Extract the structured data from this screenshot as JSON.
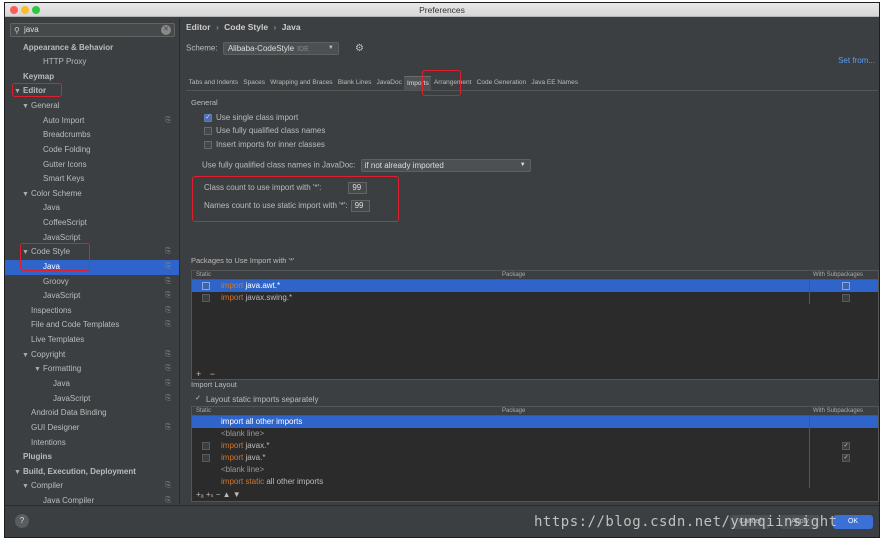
{
  "window": {
    "title": "Preferences"
  },
  "search": {
    "value": "java"
  },
  "sidebar": {
    "items": [
      {
        "label": "Appearance & Behavior",
        "depth": 0,
        "bold": true,
        "arrow": ""
      },
      {
        "label": "HTTP Proxy",
        "depth": 2,
        "arrow": ""
      },
      {
        "label": "Keymap",
        "depth": 0,
        "bold": true,
        "arrow": ""
      },
      {
        "label": "Editor",
        "depth": 0,
        "bold": true,
        "arrow": "▼"
      },
      {
        "label": "General",
        "depth": 1,
        "arrow": "▼"
      },
      {
        "label": "Auto Import",
        "depth": 2,
        "arrow": "",
        "doc": true
      },
      {
        "label": "Breadcrumbs",
        "depth": 2,
        "arrow": ""
      },
      {
        "label": "Code Folding",
        "depth": 2,
        "arrow": ""
      },
      {
        "label": "Gutter Icons",
        "depth": 2,
        "arrow": ""
      },
      {
        "label": "Smart Keys",
        "depth": 2,
        "arrow": ""
      },
      {
        "label": "Color Scheme",
        "depth": 1,
        "arrow": "▼"
      },
      {
        "label": "Java",
        "depth": 2,
        "arrow": ""
      },
      {
        "label": "CoffeeScript",
        "depth": 2,
        "arrow": ""
      },
      {
        "label": "JavaScript",
        "depth": 2,
        "arrow": ""
      },
      {
        "label": "Code Style",
        "depth": 1,
        "arrow": "▼",
        "doc": true
      },
      {
        "label": "Java",
        "depth": 2,
        "arrow": "",
        "doc": true,
        "selected": true
      },
      {
        "label": "Groovy",
        "depth": 2,
        "arrow": "",
        "doc": true
      },
      {
        "label": "JavaScript",
        "depth": 2,
        "arrow": "",
        "doc": true
      },
      {
        "label": "Inspections",
        "depth": 1,
        "arrow": "",
        "doc": true
      },
      {
        "label": "File and Code Templates",
        "depth": 1,
        "arrow": "",
        "doc": true
      },
      {
        "label": "Live Templates",
        "depth": 1,
        "arrow": ""
      },
      {
        "label": "Copyright",
        "depth": 1,
        "arrow": "▼",
        "doc": true
      },
      {
        "label": "Formatting",
        "depth": 2,
        "arrow": "▼",
        "doc": true,
        "indent": 1
      },
      {
        "label": "Java",
        "depth": 3,
        "arrow": "",
        "doc": true
      },
      {
        "label": "JavaScript",
        "depth": 3,
        "arrow": "",
        "doc": true
      },
      {
        "label": "Android Data Binding",
        "depth": 1,
        "arrow": ""
      },
      {
        "label": "GUI Designer",
        "depth": 1,
        "arrow": "",
        "doc": true
      },
      {
        "label": "Intentions",
        "depth": 1,
        "arrow": ""
      },
      {
        "label": "Plugins",
        "depth": 0,
        "bold": true,
        "arrow": ""
      },
      {
        "label": "Build, Execution, Deployment",
        "depth": 0,
        "bold": true,
        "arrow": "▼"
      },
      {
        "label": "Compiler",
        "depth": 1,
        "arrow": "▼",
        "doc": true
      },
      {
        "label": "Java Compiler",
        "depth": 2,
        "arrow": "",
        "doc": true
      }
    ]
  },
  "breadcrumb": {
    "p1": "Editor",
    "sep": "›",
    "p2": "Code Style",
    "p3": "Java"
  },
  "scheme": {
    "label": "Scheme:",
    "value": "Alibaba-CodeStyle",
    "tag": "IDE"
  },
  "set_from": "Set from...",
  "tabs": [
    {
      "label": "Tabs and Indents"
    },
    {
      "label": "Spaces"
    },
    {
      "label": "Wrapping and Braces"
    },
    {
      "label": "Blank Lines"
    },
    {
      "label": "JavaDoc"
    },
    {
      "label": "Imports",
      "active": true
    },
    {
      "label": "Arrangement"
    },
    {
      "label": "Code Generation"
    },
    {
      "label": "Java EE Names"
    }
  ],
  "general": {
    "title": "General",
    "single_class": {
      "label": "Use single class import",
      "checked": true
    },
    "fully_qualified": {
      "label": "Use fully qualified class names",
      "checked": false
    },
    "inner_classes": {
      "label": "Insert imports for inner classes",
      "checked": false
    },
    "javadoc_label": "Use fully qualified class names in JavaDoc:",
    "javadoc_value": "if not already imported",
    "class_count_label": "Class count to use import with '*':",
    "class_count": "99",
    "names_count_label": "Names count to use static import with '*':",
    "names_count": "99"
  },
  "packages": {
    "title": "Packages to Use Import with '*'",
    "col_static": "Static",
    "col_package": "Package",
    "col_sub": "With Subpackages",
    "rows": [
      {
        "kw": "import",
        "pkg": " java.awt.*",
        "static": false,
        "sub": false,
        "selected": true
      },
      {
        "kw": "import",
        "pkg": " javax.swing.*",
        "static": false,
        "sub": false
      }
    ],
    "add": "+",
    "remove": "−"
  },
  "layout": {
    "title": "Import Layout",
    "separately": {
      "label": "Layout static imports separately",
      "checked": true
    },
    "col_static": "Static",
    "col_package": "Package",
    "col_sub": "With Subpackages",
    "rows": [
      {
        "kw": "",
        "pkg": "import all other imports",
        "selected": true,
        "cb": false
      },
      {
        "kw": "",
        "pkg": "<blank line>",
        "blank": true,
        "cb": false
      },
      {
        "kw": "import",
        "pkg": " javax.*",
        "cb": true,
        "sub": true
      },
      {
        "kw": "import",
        "pkg": " java.*",
        "cb": true,
        "sub": true
      },
      {
        "kw": "",
        "pkg": "<blank line>",
        "blank": true,
        "cb": false
      },
      {
        "kw": "import static",
        "pkg": " all other imports",
        "cb": false
      }
    ],
    "toolbar": "+ₐ +ₛ − ▲ ▼"
  },
  "buttons": {
    "help": "?",
    "cancel": "Cancel",
    "apply": "Apply",
    "ok": "OK"
  },
  "watermark": "https://blog.csdn.net/yunqiinsight",
  "colors": {
    "accent": "#2f65ca",
    "keyword": "#cc7832",
    "highlight": "#e01e2c"
  }
}
